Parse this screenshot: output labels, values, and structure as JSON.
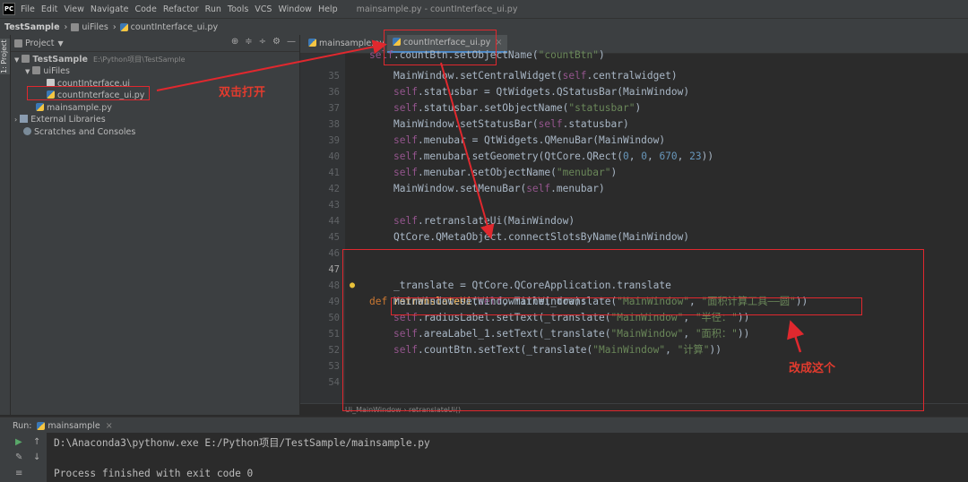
{
  "menubar": {
    "logo": "PC",
    "items": [
      "File",
      "Edit",
      "View",
      "Navigate",
      "Code",
      "Refactor",
      "Run",
      "Tools",
      "VCS",
      "Window",
      "Help"
    ],
    "window_title": "mainsample.py - countInterface_ui.py"
  },
  "navbar": {
    "crumbs": [
      "TestSample",
      "uiFiles",
      "countInterface_ui.py"
    ]
  },
  "sidestrip": {
    "label": "1: Project"
  },
  "project": {
    "header": "Project",
    "tree": [
      {
        "label": "TestSample",
        "path": "E:\\Python项目\\TestSample",
        "icon": "folder-icon"
      },
      {
        "label": "uiFiles",
        "icon": "folder-icon"
      },
      {
        "label": "countInterface.ui",
        "icon": "ui-file-icon"
      },
      {
        "label": "countInterface_ui.py",
        "icon": "python-file-icon"
      },
      {
        "label": "mainsample.py",
        "icon": "python-file-icon"
      },
      {
        "label": "External Libraries",
        "icon": "library-icon"
      },
      {
        "label": "Scratches and Consoles",
        "icon": "scratch-icon"
      }
    ]
  },
  "tabs": [
    "mainsample.py",
    "countInterface_ui.py"
  ],
  "code": {
    "line_numbers": [
      "35",
      "36",
      "37",
      "38",
      "39",
      "40",
      "41",
      "42",
      "43",
      "44",
      "45",
      "46",
      "47",
      "48",
      "49",
      "50",
      "51",
      "52",
      "53",
      "54"
    ],
    "partial_top": "self.countBtn.setObjectName(\"countBtn\")"
  },
  "breadcrumb": {
    "a": "Ui_MainWindow",
    "b": "retranslateUi()"
  },
  "run": {
    "label": "Run:",
    "config": "mainsample",
    "command": "D:\\Anaconda3\\pythonw.exe E:/Python项目/TestSample/mainsample.py",
    "result": "Process finished with exit code 0"
  },
  "annotations": {
    "double_click": "双击打开",
    "change_this": "改成这个"
  },
  "colors": {
    "keyword": "#cc7832",
    "string": "#6a8759",
    "self": "#94558d",
    "number": "#6897bb",
    "function": "#ffc66d",
    "annotation": "#e0282e"
  }
}
